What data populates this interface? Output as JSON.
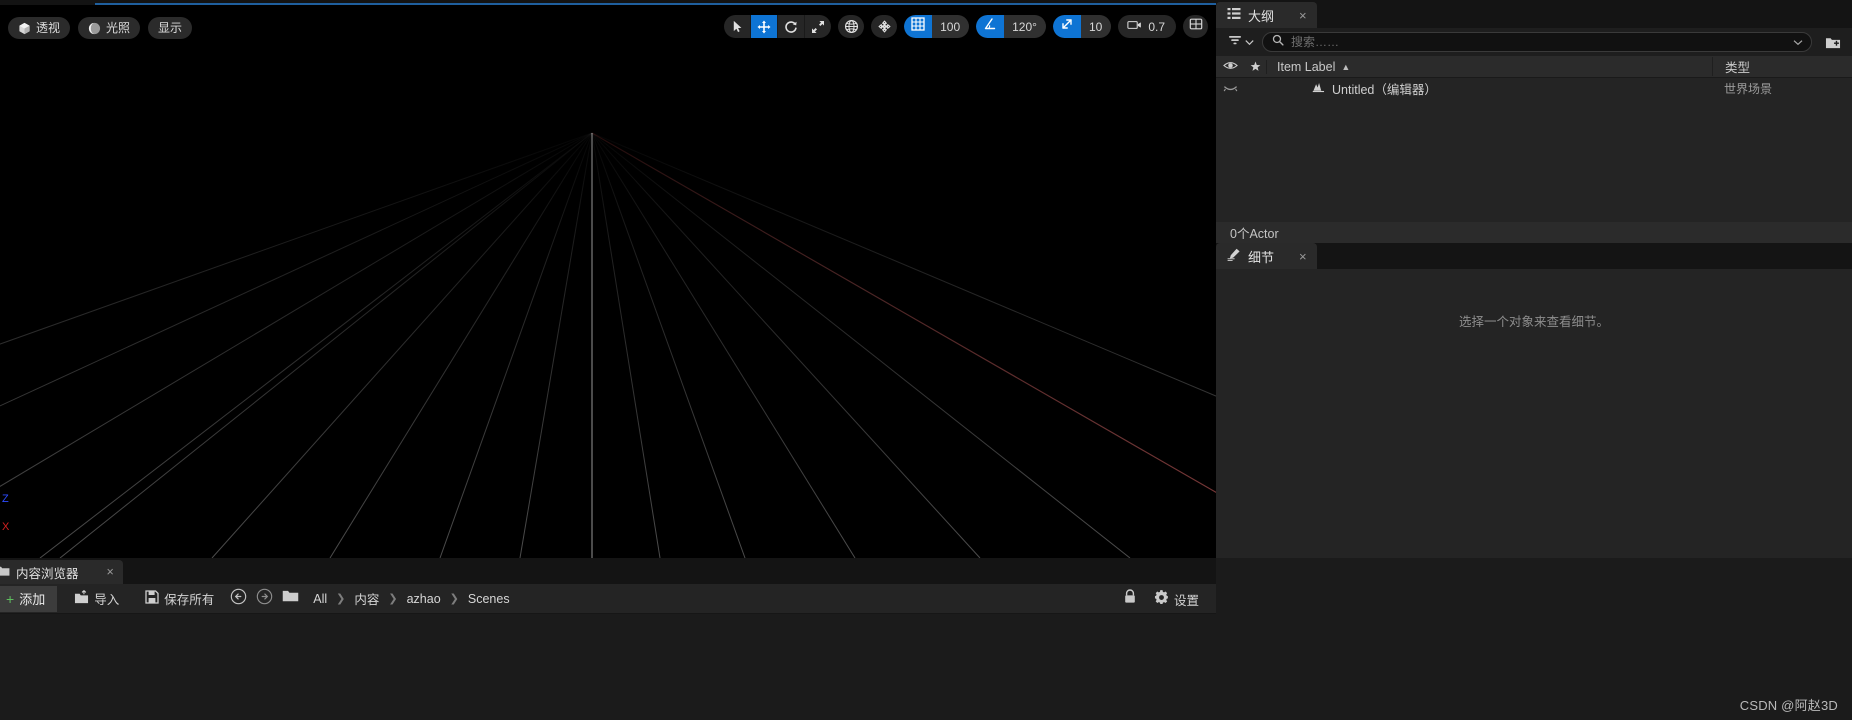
{
  "viewport": {
    "left_tools": [
      {
        "label": "透视",
        "icon": "cube-icon",
        "name": "perspective-button"
      },
      {
        "label": "光照",
        "icon": "lit-sphere-icon",
        "name": "lit-mode-button"
      },
      {
        "label": "显示",
        "icon": "none",
        "name": "show-flags-button"
      }
    ],
    "transform_tools": [
      {
        "icon": "select-cursor-icon",
        "name": "select-tool",
        "active": false
      },
      {
        "icon": "move-arrows-icon",
        "name": "move-tool",
        "active": true
      },
      {
        "icon": "rotate-icon",
        "name": "rotate-tool",
        "active": false
      },
      {
        "icon": "scale-icon",
        "name": "scale-tool",
        "active": false
      }
    ],
    "coord_tools": [
      {
        "icon": "globe-icon",
        "name": "world-space-toggle",
        "active": false
      },
      {
        "icon": "surface-snap-icon",
        "name": "surface-snap-toggle",
        "active": false
      }
    ],
    "snaps": [
      {
        "icon": "grid-snap-icon",
        "name": "grid-snap",
        "value": "100",
        "enabled": true
      },
      {
        "icon": "angle-snap-icon",
        "name": "angle-snap",
        "value": "120°",
        "enabled": true
      },
      {
        "icon": "scale-snap-icon",
        "name": "scale-snap",
        "value": "10",
        "enabled": true
      }
    ],
    "camera_speed": {
      "icon": "camera-icon",
      "name": "camera-speed",
      "value": "0.7"
    },
    "maximize": {
      "icon": "viewport-layout-icon",
      "name": "viewport-layout-button"
    },
    "gizmo": {
      "z_label": "Z",
      "x_label": "X",
      "z_color": "#2d4cff",
      "x_color": "#d42020"
    }
  },
  "outliner": {
    "tab": {
      "label": "大纲",
      "icon": "outliner-icon",
      "close": "×"
    },
    "filter": {
      "icon": "filter-icon",
      "chevron": "chevron-down-icon"
    },
    "search": {
      "placeholder": "搜索……",
      "value": "",
      "icon": "search-icon",
      "chevron": "chevron-down-icon"
    },
    "add_item": {
      "icon": "add-folder-icon"
    },
    "columns": {
      "eye": "eye-icon",
      "star": "★",
      "label": "Item Label",
      "sort": "▲",
      "type": "类型"
    },
    "rows": [
      {
        "label": "Untitled（编辑器）",
        "type": "世界场景",
        "icon": "world-icon",
        "visibility": "closed-eye-icon"
      }
    ],
    "footer": "0个Actor"
  },
  "details": {
    "tab": {
      "label": "细节",
      "icon": "details-pencil-icon",
      "close": "×"
    },
    "empty_message": "选择一个对象来查看细节。"
  },
  "content_browser": {
    "tab": {
      "label": "内容浏览器",
      "icon": "folder-icon",
      "close": "×"
    },
    "add_button": {
      "label": "添加",
      "plus": "+"
    },
    "import_button": {
      "label": "导入",
      "icon": "import-icon"
    },
    "save_all_button": {
      "label": "保存所有",
      "icon": "save-icon"
    },
    "nav_back": {
      "icon": "back-arrow-icon"
    },
    "nav_forward": {
      "icon": "forward-arrow-icon"
    },
    "path_icon": "folder-icon",
    "breadcrumbs": [
      "All",
      "内容",
      "azhao",
      "Scenes"
    ],
    "breadcrumb_separator": "❯",
    "lock_button": {
      "icon": "lock-icon"
    },
    "settings_button": {
      "label": "设置",
      "icon": "gear-icon"
    }
  },
  "watermark": "CSDN @阿赵3D",
  "colors": {
    "accent_blue": "#0e74d4",
    "panel_bg": "#242424",
    "dock_bg": "#1b1b1b",
    "tab_bg": "#2a2a2a",
    "viewport_bg": "#000000",
    "text": "#dcdcdc"
  }
}
